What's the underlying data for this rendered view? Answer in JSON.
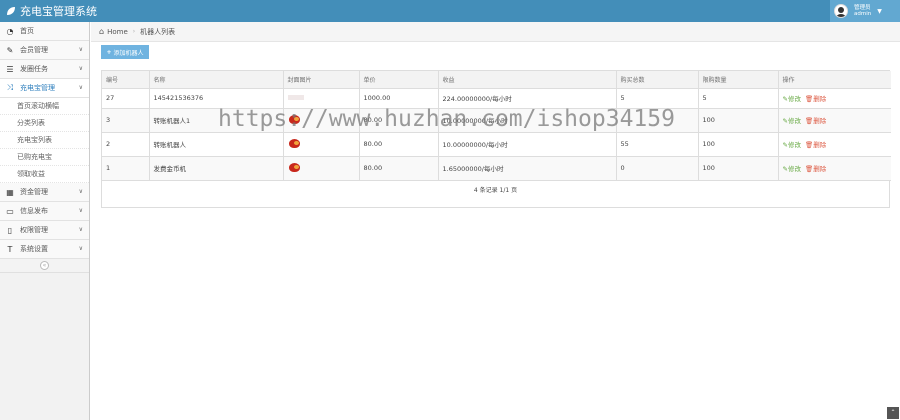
{
  "header": {
    "title": "充电宝管理系统",
    "user_role": "管理员",
    "user_name": "admin"
  },
  "sidebar": {
    "items": [
      {
        "icon": "tachometer-icon",
        "label": "首页"
      },
      {
        "icon": "edit-icon",
        "label": "会员管理"
      },
      {
        "icon": "list-icon",
        "label": "发圈任务"
      },
      {
        "icon": "shuffle-icon",
        "label": "充电宝管理"
      }
    ],
    "subitems": [
      "首页滚动横幅",
      "分类列表",
      "充电宝列表",
      "已购充电宝",
      "领取收益"
    ],
    "items_after": [
      {
        "icon": "calendar-icon",
        "label": "资金管理"
      },
      {
        "icon": "credit-card-icon",
        "label": "信息发布"
      },
      {
        "icon": "file-icon",
        "label": "权限管理"
      },
      {
        "icon": "text-width-icon",
        "label": "系统设置"
      }
    ]
  },
  "breadcrumb": {
    "home": "Home",
    "current": "机器人列表"
  },
  "toolbar": {
    "add_label": "添加机器人"
  },
  "table": {
    "columns": [
      "编号",
      "名称",
      "封面图片",
      "单价",
      "收益",
      "购买总数",
      "限购数量",
      "操作"
    ],
    "rows": [
      {
        "id": "27",
        "name": "145421536376",
        "thumb": "small",
        "price": "1000.00",
        "income": "224.00000000/每小时",
        "total": "5",
        "limit": "5"
      },
      {
        "id": "3",
        "name": "转账机器人1",
        "thumb": "bird",
        "price": "80.00",
        "income": "10.00000000/每小时",
        "total": "",
        "limit": "100"
      },
      {
        "id": "2",
        "name": "转账机器人",
        "thumb": "bird",
        "price": "80.00",
        "income": "10.00000000/每小时",
        "total": "55",
        "limit": "100"
      },
      {
        "id": "1",
        "name": "发费金币机",
        "thumb": "bird",
        "price": "80.00",
        "income": "1.65000000/每小时",
        "total": "0",
        "limit": "100"
      }
    ],
    "edit_label": "修改",
    "delete_label": "删除",
    "pager": "4 条记录 1/1 页"
  },
  "watermark": "https://www.huzhan.com/ishop34159"
}
